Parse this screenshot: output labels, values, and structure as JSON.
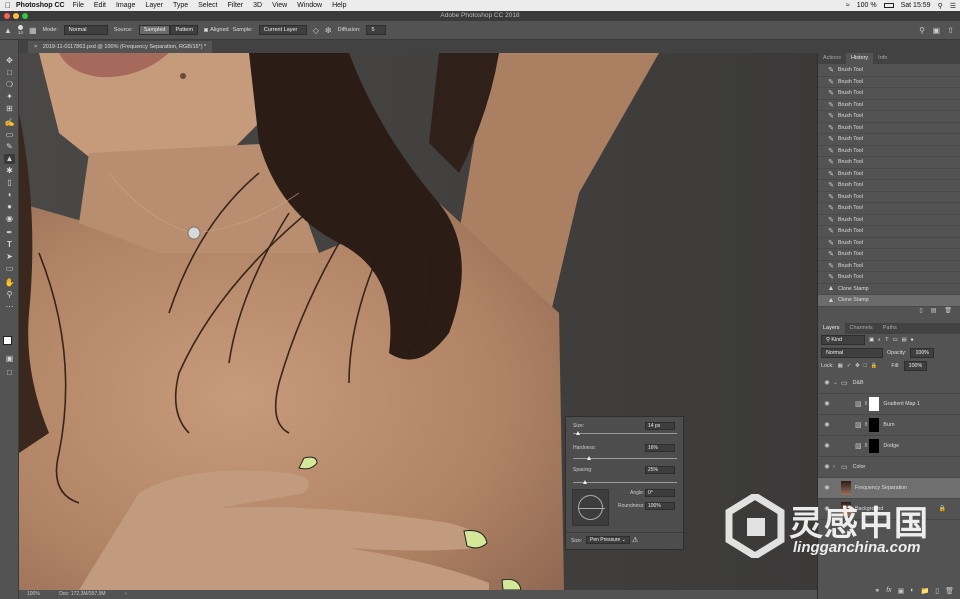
{
  "menubar": {
    "app": "Photoshop CC",
    "items": [
      "File",
      "Edit",
      "Image",
      "Layer",
      "Type",
      "Select",
      "Filter",
      "3D",
      "View",
      "Window",
      "Help"
    ],
    "battery": "100 %",
    "clock": "Sat 15:59"
  },
  "window_title": "Adobe Photoshop CC 2018",
  "options": {
    "brush_size": "14",
    "mode_label": "Mode:",
    "mode_value": "Normal",
    "source_label": "Source:",
    "sampled": "Sampled",
    "pattern": "Pattern",
    "aligned": "Aligned",
    "sample_label": "Sample:",
    "sample_value": "Current Layer",
    "diffusion_label": "Diffusion:",
    "diffusion_value": "5"
  },
  "doc_tab": "2019-11-0117863.psd @ 100% (Frequency Separation, RGB/16*) *",
  "status": {
    "zoom": "100%",
    "doc": "Doc: 172,3M/357,9M"
  },
  "history_panel": {
    "tabs": [
      "Actions",
      "History",
      "Info"
    ],
    "active_tab": "History",
    "items": [
      "Brush Tool",
      "Brush Tool",
      "Brush Tool",
      "Brush Tool",
      "Brush Tool",
      "Brush Tool",
      "Brush Tool",
      "Brush Tool",
      "Brush Tool",
      "Brush Tool",
      "Brush Tool",
      "Brush Tool",
      "Brush Tool",
      "Brush Tool",
      "Brush Tool",
      "Brush Tool",
      "Brush Tool",
      "Brush Tool",
      "Brush Tool",
      "Clone Stamp",
      "Clone Stamp"
    ]
  },
  "layers_panel": {
    "tabs": [
      "Layers",
      "Channels",
      "Paths"
    ],
    "active_tab": "Layers",
    "filter": "Kind",
    "blend": "Normal",
    "opacity_label": "Opacity:",
    "opacity": "100%",
    "lock_label": "Lock:",
    "fill_label": "Fill:",
    "fill": "100%",
    "layers": [
      {
        "name": "D&B",
        "kind": "group"
      },
      {
        "name": "Gradient Map 1",
        "kind": "adjust"
      },
      {
        "name": "Burn",
        "kind": "curve"
      },
      {
        "name": "Dodge",
        "kind": "curve"
      },
      {
        "name": "Color",
        "kind": "group"
      },
      {
        "name": "Frequency Separation",
        "kind": "pixel"
      },
      {
        "name": "Background",
        "kind": "pixel"
      }
    ]
  },
  "brush_popup": {
    "size_label": "Size:",
    "size_value": "14 px",
    "hardness_label": "Hardness:",
    "hardness_value": "16%",
    "spacing_label": "Spacing:",
    "spacing_value": "25%",
    "angle_label": "Angle:",
    "angle_value": "0°",
    "roundness_label": "Roundness:",
    "roundness_value": "100%",
    "footer_label": "Size:",
    "footer_value": "Pen Pressure",
    "size_fraction": 0.05,
    "hardness_fraction": 0.16,
    "spacing_fraction": 0.12
  },
  "watermark": {
    "cn": "灵感中国",
    "url": "lingganchina.com"
  }
}
